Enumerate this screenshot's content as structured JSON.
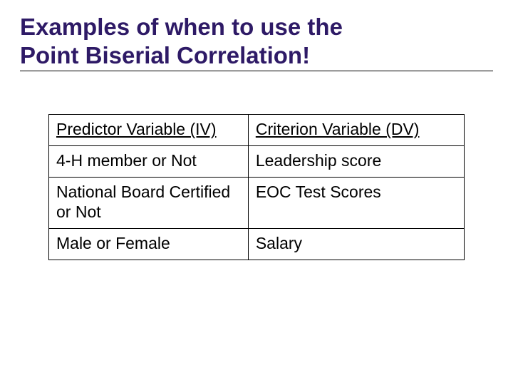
{
  "title_line1": "Examples of when to use the",
  "title_line2": "Point Biserial Correlation!",
  "table": {
    "header": {
      "left": "Predictor Variable (IV)",
      "right": "Criterion Variable (DV)"
    },
    "rows": [
      {
        "left": "4-H member or Not",
        "right": "Leadership score"
      },
      {
        "left": "National Board Certified or Not",
        "right": "EOC Test Scores"
      },
      {
        "left": "Male or Female",
        "right": "Salary"
      }
    ]
  }
}
